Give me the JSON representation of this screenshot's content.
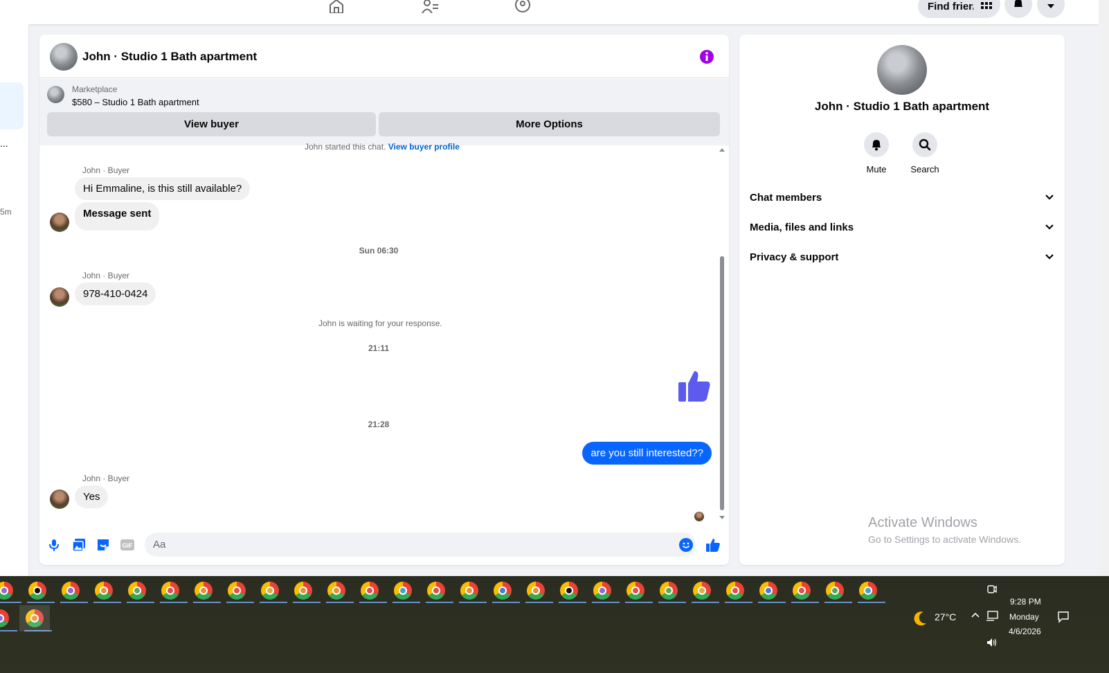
{
  "topnav": {
    "icons": [
      "home-icon",
      "friends-icon",
      "groups-icon"
    ],
    "find_friends_label": "Find friends",
    "menu_icon": "grid-menu-icon",
    "notifications_icon": "bell-icon",
    "account_icon": "caret-down-icon"
  },
  "left_strip": {
    "dots": "...",
    "time": "5m"
  },
  "chat": {
    "header_title": "John · Studio 1 Bath apartment",
    "marketplace_label": "Marketplace",
    "listing": "$580 – Studio 1 Bath apartment",
    "view_buyer_label": "View buyer",
    "more_options_label": "More Options",
    "started_text": "John started this chat.",
    "view_profile_link": "View buyer profile",
    "sender_label": "John · Buyer",
    "messages": {
      "m1": "Hi Emmaline, is this still available?",
      "m2": "Message sent",
      "ts1": "Sun 06:30",
      "m3": "978-410-0424",
      "waiting": "John is waiting for your response.",
      "ts2": "21:11",
      "ts3": "21:28",
      "out1": "are you still interested??",
      "m4": "Yes"
    },
    "composer_placeholder": "Aa",
    "accent_color": "#0866ff",
    "thumb_color": "#5b5bf0"
  },
  "right_panel": {
    "title": "John · Studio 1 Bath apartment",
    "mute_label": "Mute",
    "search_label": "Search",
    "rows": [
      "Chat members",
      "Media, files and links",
      "Privacy & support"
    ],
    "activate_title": "Activate Windows",
    "activate_sub": "Go to Settings to activate Windows."
  },
  "taskbar": {
    "weather": "27°C",
    "time": "9:28 PM",
    "day": "Monday",
    "date": "4/6/2026"
  }
}
